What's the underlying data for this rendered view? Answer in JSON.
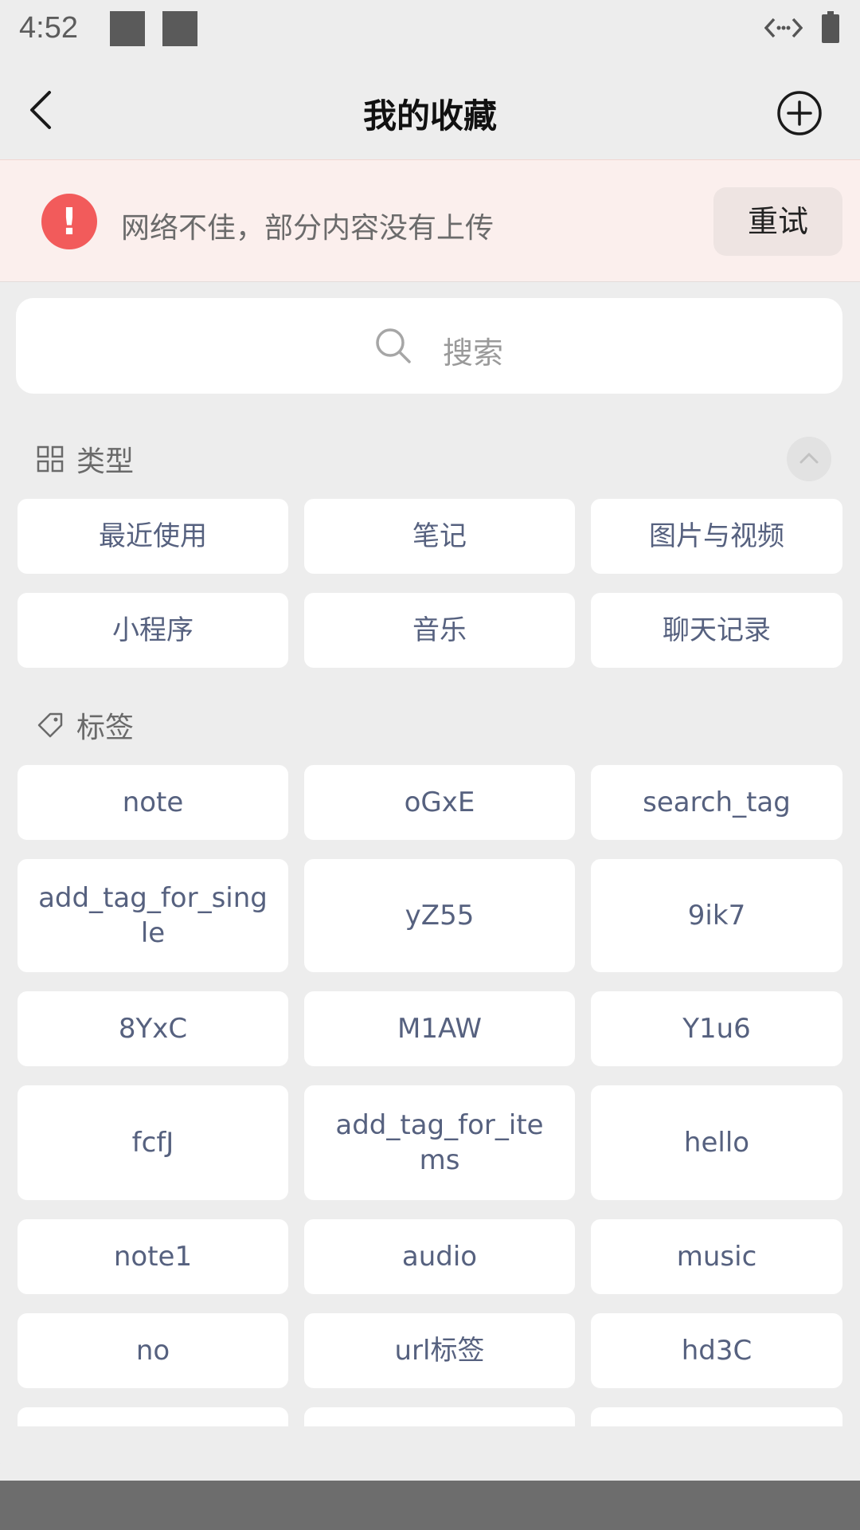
{
  "status": {
    "time": "4:52"
  },
  "header": {
    "title": "我的收藏"
  },
  "banner": {
    "message": "网络不佳，部分内容没有上传",
    "retry_label": "重试"
  },
  "search": {
    "placeholder": "搜索"
  },
  "types": {
    "label": "类型",
    "items": [
      "最近使用",
      "笔记",
      "图片与视频",
      "小程序",
      "音乐",
      "聊天记录"
    ]
  },
  "tags": {
    "label": "标签",
    "items": [
      "note",
      "oGxE",
      "search_tag",
      "add_tag_for_single",
      "yZ55",
      "9ik7",
      "8YxC",
      "M1AW",
      "Y1u6",
      "fcfJ",
      "add_tag_for_items",
      "hello",
      "note1",
      "audio",
      "music",
      "no",
      "url标签",
      "hd3C"
    ]
  },
  "colors": {
    "chip_text": "#56617f",
    "warning": "#f25b5b",
    "banner_bg": "#fbefed"
  }
}
